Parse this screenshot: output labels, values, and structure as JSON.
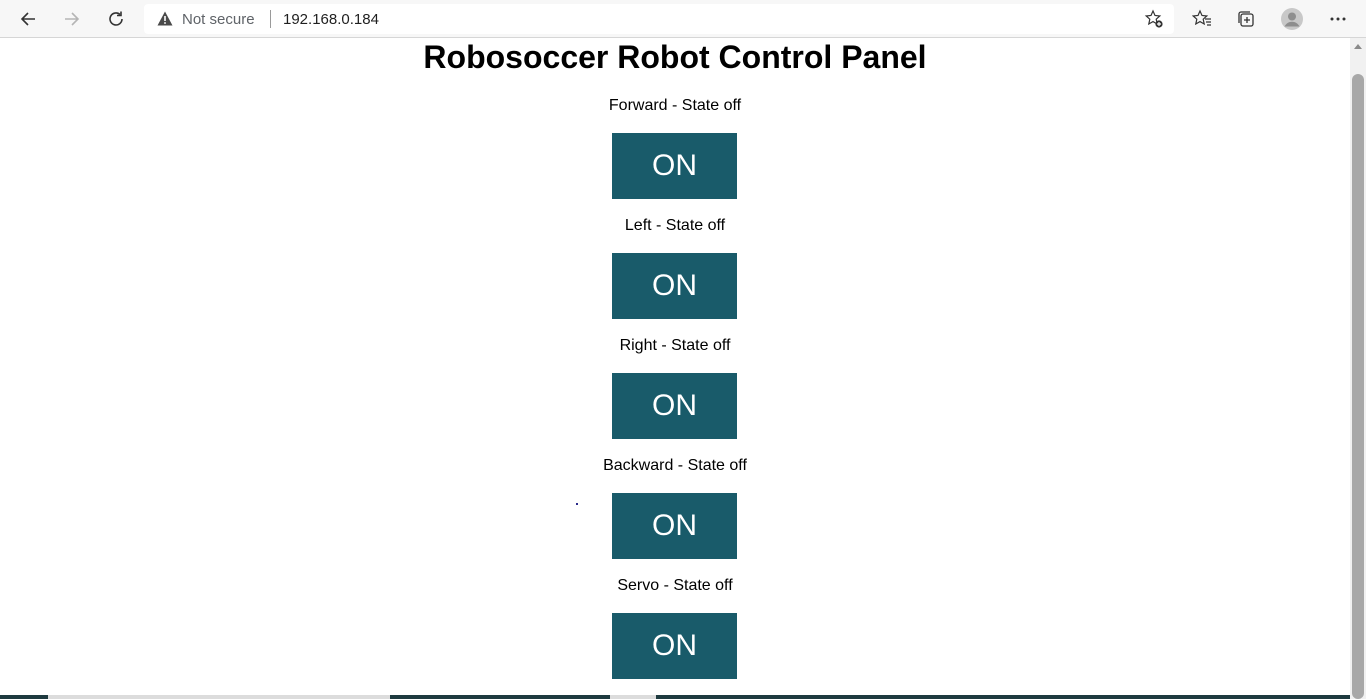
{
  "browser": {
    "security_label": "Not secure",
    "url": "192.168.0.184",
    "icons": {
      "back": "back-arrow-icon",
      "forward": "forward-arrow-icon",
      "reload": "reload-icon",
      "warning": "warning-triangle-icon",
      "add_favorite": "star-plus-icon",
      "favorites": "favorites-icon",
      "collections": "collections-icon",
      "profile": "avatar-icon",
      "menu": "more-dots-icon"
    }
  },
  "page": {
    "title": "Robosoccer Robot Control Panel",
    "button_color": "#195b6a",
    "controls": [
      {
        "label": "Forward - State off",
        "button": "ON"
      },
      {
        "label": "Left - State off",
        "button": "ON"
      },
      {
        "label": "Right - State off",
        "button": "ON"
      },
      {
        "label": "Backward - State off",
        "button": "ON"
      },
      {
        "label": "Servo - State off",
        "button": "ON"
      }
    ]
  }
}
